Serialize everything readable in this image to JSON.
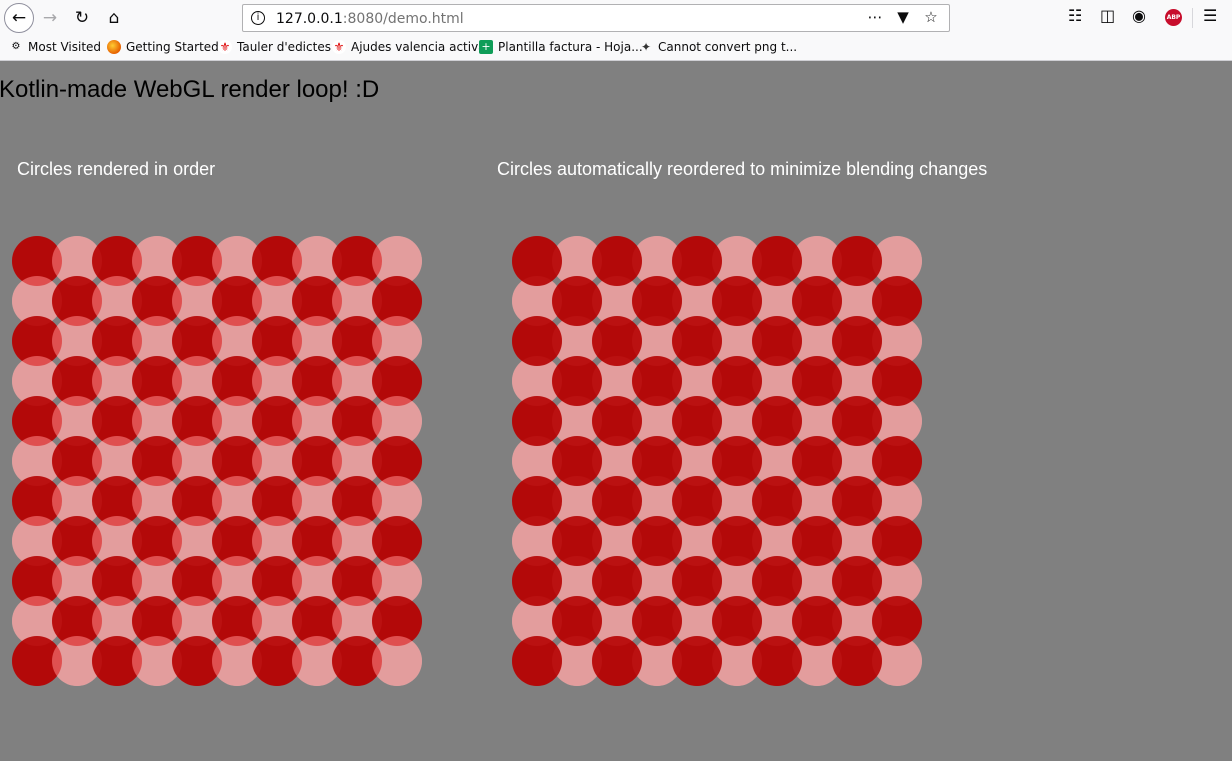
{
  "browser": {
    "url_host": "127.0.0.1",
    "url_rest": ":8080/demo.html",
    "icons": [
      "back-arrow-icon",
      "forward-arrow-icon",
      "reload-icon",
      "home-icon",
      "info-icon",
      "more-dots-icon",
      "pocket-icon",
      "bookmark-star-icon",
      "library-icon",
      "sidebar-icon",
      "account-icon",
      "adblock-icon",
      "menu-icon"
    ],
    "adblock_label": "ABP",
    "bookmarks": [
      {
        "label": "Most Visited",
        "icon": "gear-icon"
      },
      {
        "label": "Getting Started",
        "icon": "firefox-icon"
      },
      {
        "label": "Tauler d'edictes",
        "icon": "valencia-crest-icon"
      },
      {
        "label": "Ajudes valencia activa",
        "icon": "valencia-crest-icon"
      },
      {
        "label": "Plantilla factura - Hoja...",
        "icon": "sheets-icon"
      },
      {
        "label": "Cannot convert png t...",
        "icon": "magic-wand-icon"
      }
    ]
  },
  "page": {
    "title": "Kotlin-made WebGL render loop! :D",
    "panels": [
      {
        "title": "Circles rendered in order",
        "mode": "in-order"
      },
      {
        "title": "Circles automatically reordered to minimize blending changes",
        "mode": "reordered"
      }
    ],
    "grid": {
      "columns": 10,
      "rows": 11
    },
    "colors": {
      "background": "#808080",
      "opaque_circle": "#b00000",
      "translucent_circle": "#ff8080",
      "overlap": "#ff0000"
    }
  }
}
